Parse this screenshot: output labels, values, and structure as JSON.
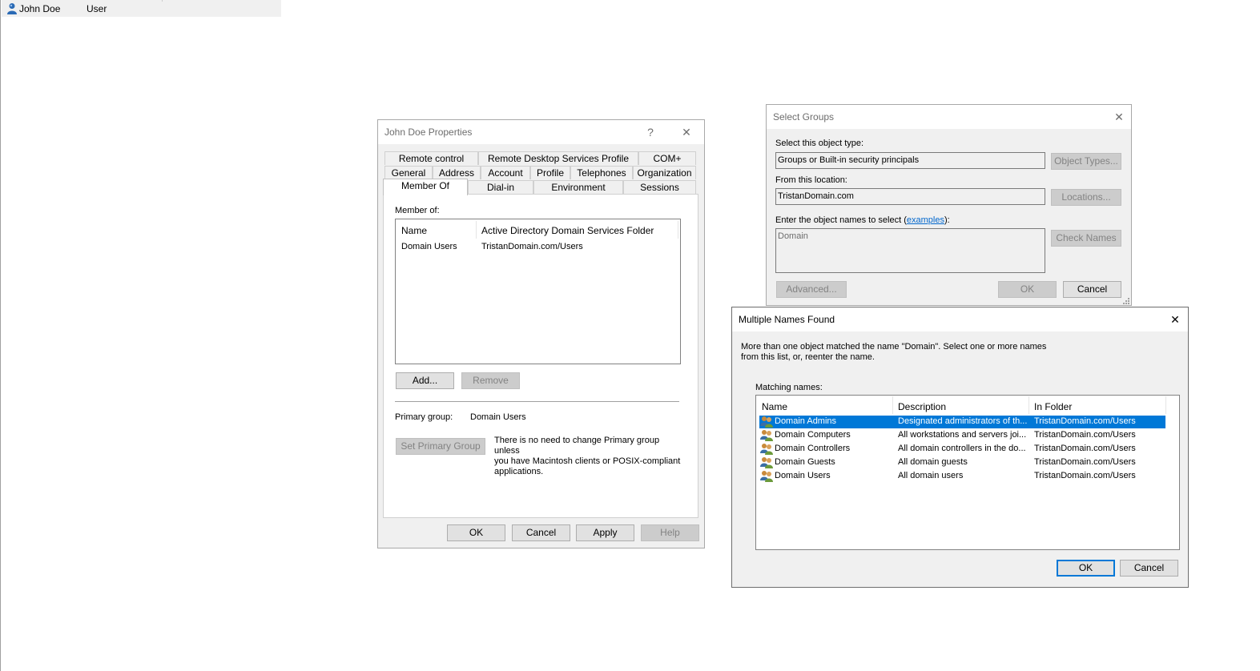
{
  "background_list": {
    "row": {
      "name": "John Doe",
      "type": "User",
      "icon": "user-icon"
    }
  },
  "properties_dialog": {
    "title": "John Doe Properties",
    "help_glyph": "?",
    "close_glyph": "✕",
    "tabs_row1": [
      "Remote control",
      "Remote Desktop Services Profile",
      "COM+"
    ],
    "tabs_row2": [
      "General",
      "Address",
      "Account",
      "Profile",
      "Telephones",
      "Organization"
    ],
    "tabs_row3": [
      "Member Of",
      "Dial-in",
      "Environment",
      "Sessions"
    ],
    "selected_tab": "Member Of",
    "member_of_label": "Member of:",
    "list_headers": {
      "name": "Name",
      "folder": "Active Directory Domain Services Folder"
    },
    "list_rows": [
      {
        "name": "Domain Users",
        "folder": "TristanDomain.com/Users"
      }
    ],
    "add_button": "Add...",
    "remove_button": "Remove",
    "primary_group_label": "Primary group:",
    "primary_group_value": "Domain Users",
    "set_primary_button": "Set Primary Group",
    "note_lines": [
      "There is no need to change Primary group unless",
      "you have Macintosh clients or POSIX-compliant",
      "applications."
    ],
    "ok_button": "OK",
    "cancel_button": "Cancel",
    "apply_button": "Apply",
    "help_button": "Help"
  },
  "select_groups_dialog": {
    "title": "Select Groups",
    "close_glyph": "✕",
    "object_type_label": "Select this object type:",
    "object_type_value": "Groups or Built-in security principals",
    "object_types_button": "Object Types...",
    "location_label": "From this location:",
    "location_value": "TristanDomain.com",
    "locations_button": "Locations...",
    "names_label_prefix": "Enter the object names to select (",
    "names_label_link": "examples",
    "names_label_suffix": "):",
    "names_value": "Domain",
    "check_names_button": "Check Names",
    "advanced_button": "Advanced...",
    "ok_button": "OK",
    "cancel_button": "Cancel"
  },
  "multiple_names_dialog": {
    "title": "Multiple Names Found",
    "close_glyph": "✕",
    "message_line1": "More than one object matched the name \"Domain\". Select one or more names",
    "message_line2": "from this list, or, reenter the name.",
    "matching_label": "Matching names:",
    "headers": {
      "name": "Name",
      "description": "Description",
      "folder": "In Folder"
    },
    "rows": [
      {
        "name": "Domain Admins",
        "description": "Designated administrators of th...",
        "folder": "TristanDomain.com/Users",
        "selected": true
      },
      {
        "name": "Domain Computers",
        "description": "All workstations and servers joi...",
        "folder": "TristanDomain.com/Users",
        "selected": false
      },
      {
        "name": "Domain Controllers",
        "description": "All domain controllers in the do...",
        "folder": "TristanDomain.com/Users",
        "selected": false
      },
      {
        "name": "Domain Guests",
        "description": "All domain guests",
        "folder": "TristanDomain.com/Users",
        "selected": false
      },
      {
        "name": "Domain Users",
        "description": "All domain users",
        "folder": "TristanDomain.com/Users",
        "selected": false
      }
    ],
    "ok_button": "OK",
    "cancel_button": "Cancel"
  },
  "colors": {
    "selection": "#0078d7",
    "link": "#0066cc",
    "dialog_bg": "#f0f0f0"
  }
}
